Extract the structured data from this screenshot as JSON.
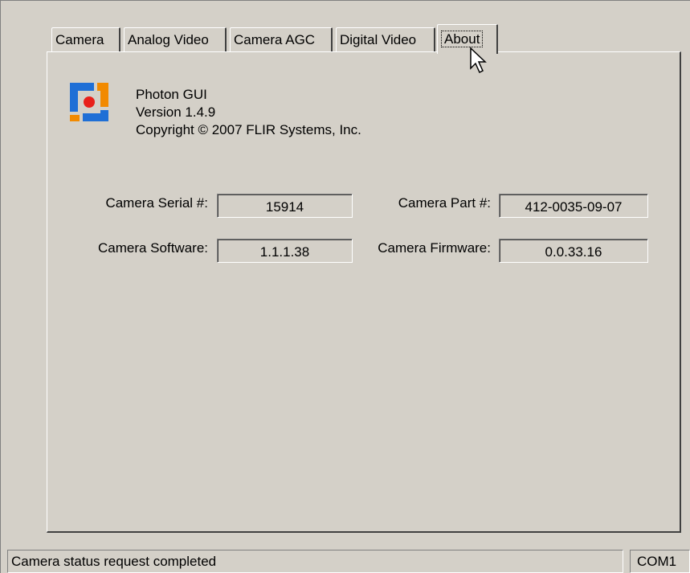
{
  "tabs": [
    {
      "label": "Camera",
      "active": false
    },
    {
      "label": "Analog Video",
      "active": false
    },
    {
      "label": "Camera AGC",
      "active": false
    },
    {
      "label": "Digital Video",
      "active": false
    },
    {
      "label": "About",
      "active": true
    }
  ],
  "about": {
    "app_name": "Photon GUI",
    "version": "Version 1.4.9",
    "copyright": "Copyright © 2007 FLIR Systems, Inc.",
    "logo_icon": "flir-logo-icon",
    "logo_colors": {
      "blue": "#1f6fd6",
      "orange": "#f28a00",
      "red": "#e8201a"
    }
  },
  "fields": {
    "serial_label": "Camera Serial #:",
    "serial_value": "15914",
    "part_label": "Camera Part #:",
    "part_value": "412-0035-09-07",
    "software_label": "Camera Software:",
    "software_value": "1.1.1.38",
    "firmware_label": "Camera Firmware:",
    "firmware_value": "0.0.33.16"
  },
  "status": {
    "message": "Camera status request completed",
    "port": "COM1"
  },
  "theme": {
    "face": "#d4d0c8",
    "shadow": "#808080",
    "dark_shadow": "#404040",
    "highlight": "#ffffff"
  }
}
